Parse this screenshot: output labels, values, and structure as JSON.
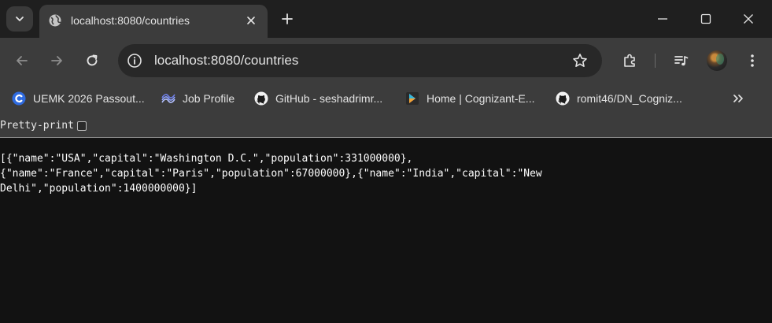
{
  "tab": {
    "title": "localhost:8080/countries"
  },
  "omnibox": {
    "url": "localhost:8080/countries"
  },
  "bookmarks": [
    {
      "label": "UEMK 2026 Passout...",
      "icon": "c-logo-icon"
    },
    {
      "label": "Job Profile",
      "icon": "job-profile-icon"
    },
    {
      "label": "GitHub - seshadrimr...",
      "icon": "github-icon"
    },
    {
      "label": "Home | Cognizant-E...",
      "icon": "cognizant-icon"
    },
    {
      "label": "romit46/DN_Cogniz...",
      "icon": "github-icon"
    }
  ],
  "pretty_print": {
    "label": "Pretty-print",
    "checked": false
  },
  "json_body": "[{\"name\":\"USA\",\"capital\":\"Washington D.C.\",\"population\":331000000},\n{\"name\":\"France\",\"capital\":\"Paris\",\"population\":67000000},{\"name\":\"India\",\"capital\":\"New\nDelhi\",\"population\":1400000000}]",
  "colors": {
    "tab_strip": "#1f1f1f",
    "toolbar": "#3c3c3c",
    "page_background": "#121212",
    "text": "#e3e3e3"
  }
}
